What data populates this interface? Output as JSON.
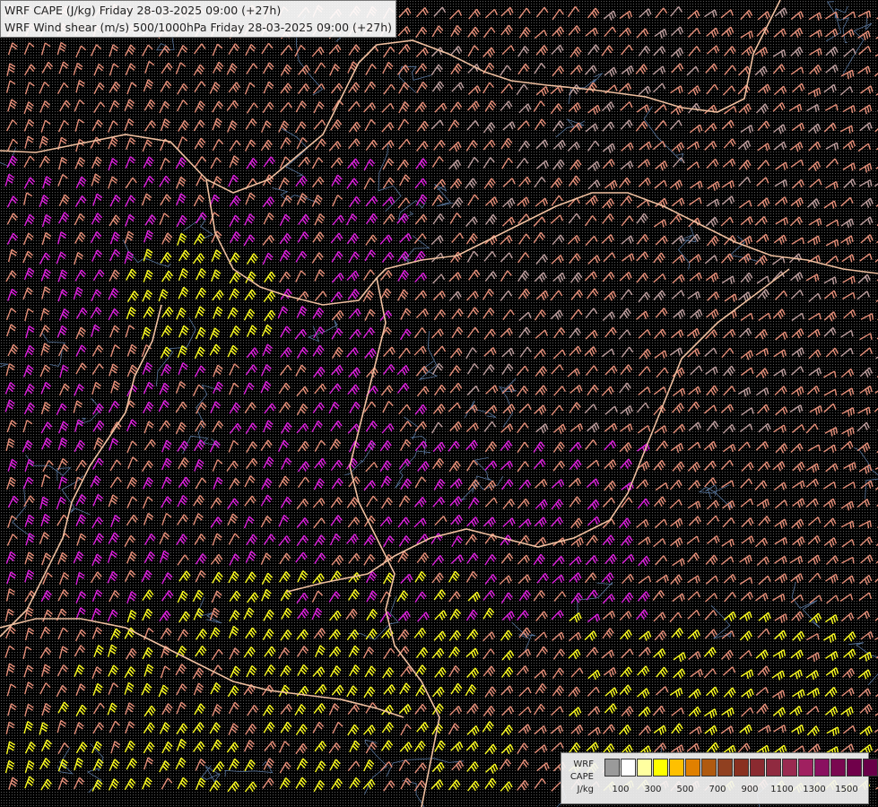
{
  "title": {
    "line1": "WRF CAPE (J/kg) Friday 28-03-2025 09:00 (+27h)",
    "line2": "WRF Wind shear (m/s) 500/1000hPa Friday 28-03-2025 09:00 (+27h)"
  },
  "legend": {
    "label_lines": [
      "WRF",
      "CAPE",
      "J/kg"
    ],
    "swatch_colors": [
      "#9a9a9a",
      "#ffffff",
      "#ffffa0",
      "#ffff00",
      "#ffc000",
      "#e08000",
      "#b05a10",
      "#904020",
      "#8a3020",
      "#8a2a30",
      "#902a40",
      "#9a2a50",
      "#a02060",
      "#8a1060",
      "#7a0850",
      "#70004a",
      "#680048"
    ],
    "tick_labels": [
      "100",
      "300",
      "500",
      "700",
      "900",
      "1100",
      "1300",
      "1500"
    ]
  },
  "colors": {
    "background": "#000000",
    "borders": "#f0c0a0",
    "rivers": "#5a78a0",
    "barb_low": "#e8907a",
    "barb_mid": "#e020e0",
    "barb_high": "#ffff20",
    "barb_calm": "#c0a0a0"
  }
}
